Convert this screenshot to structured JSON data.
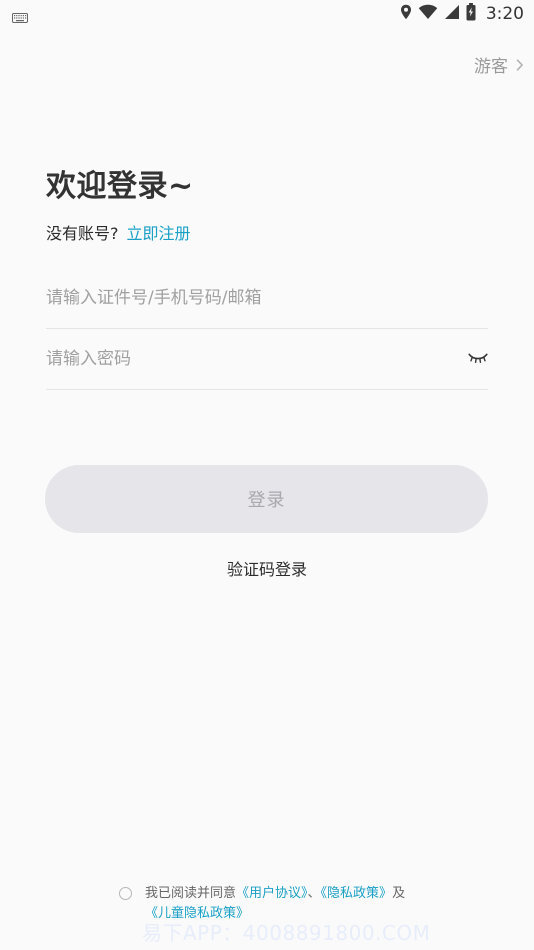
{
  "status_bar": {
    "time": "3:20"
  },
  "header": {
    "guest_label": "游客"
  },
  "main": {
    "welcome_title": "欢迎登录~",
    "register_prompt": "没有账号?",
    "register_link": "立即注册",
    "account_placeholder": "请输入证件号/手机号码/邮箱",
    "password_placeholder": "请输入密码",
    "login_label": "登录",
    "sms_login_label": "验证码登录"
  },
  "agreement": {
    "prefix": "我已阅读并同意",
    "user_agreement": "《用户协议》",
    "separator": "、",
    "privacy_policy": "《隐私政策》",
    "conjunction": "及",
    "children_privacy_policy": "《儿童隐私政策》"
  },
  "watermark_text": "易下APP：4008891800.COM",
  "colors": {
    "background": "#fafafa",
    "accent": "#1aa0c7",
    "button_bg": "#e5e5ea",
    "button_text": "#a8a8ad"
  },
  "icons": {
    "keyboard": "keyboard-icon",
    "location": "location-icon",
    "wifi": "wifi-icon",
    "signal": "signal-icon",
    "battery": "battery-charging-icon",
    "chevron": "chevron-right-icon",
    "password_visibility": "eye-closed-icon",
    "radio": "radio-icon"
  }
}
